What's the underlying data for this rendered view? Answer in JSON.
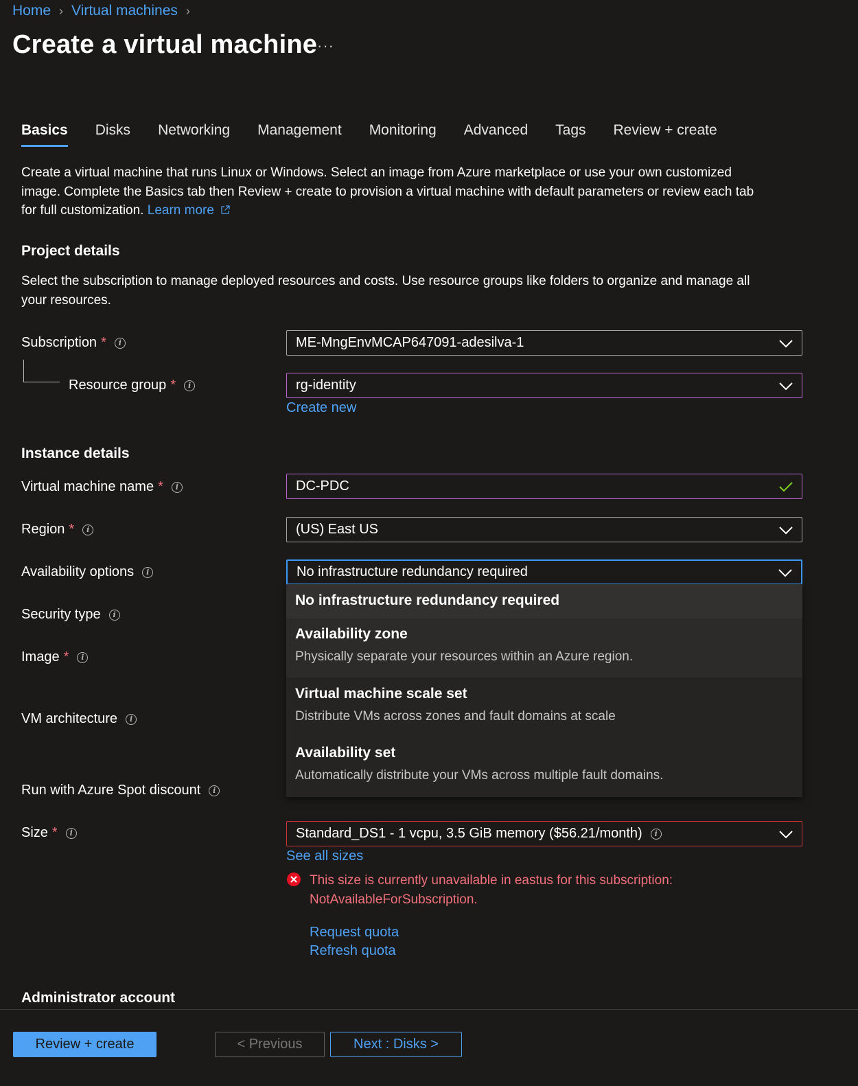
{
  "breadcrumb": {
    "home": "Home",
    "vms": "Virtual machines"
  },
  "title": "Create a virtual machine",
  "more": "···",
  "tabs": [
    "Basics",
    "Disks",
    "Networking",
    "Management",
    "Monitoring",
    "Advanced",
    "Tags",
    "Review + create"
  ],
  "intro": {
    "line1": "Create a virtual machine that runs Linux or Windows. Select an image from Azure marketplace or use your own customized",
    "line2": "image. Complete the Basics tab then Review + create to provision a virtual machine with default parameters or review each tab",
    "line3": "for full customization.",
    "learn_more": "Learn more"
  },
  "project": {
    "title": "Project details",
    "desc1": "Select the subscription to manage deployed resources and costs. Use resource groups like folders to organize and manage all",
    "desc2": "your resources.",
    "subscription_label": "Subscription",
    "subscription_value": "ME-MngEnvMCAP647091-adesilva-1",
    "rg_label": "Resource group",
    "rg_value": "rg-identity",
    "create_new": "Create new"
  },
  "instance": {
    "title": "Instance details",
    "vm_name_label": "Virtual machine name",
    "vm_name_value": "DC-PDC",
    "region_label": "Region",
    "region_value": "(US) East US",
    "availability_label": "Availability options",
    "availability_value": "No infrastructure redundancy required",
    "security_label": "Security type",
    "image_label": "Image",
    "arch_label": "VM architecture",
    "spot_label": "Run with Azure Spot discount",
    "size_label": "Size",
    "size_value": "Standard_DS1 - 1 vcpu, 3.5 GiB memory ($56.21/month)",
    "see_all_sizes": "See all sizes",
    "error1": "This size is currently unavailable in eastus for this subscription:",
    "error2": "NotAvailableForSubscription.",
    "request_quota": "Request quota",
    "refresh_quota": "Refresh quota"
  },
  "dropdown": [
    {
      "title": "No infrastructure redundancy required",
      "desc": ""
    },
    {
      "title": "Availability zone",
      "desc": "Physically separate your resources within an Azure region."
    },
    {
      "title": "Virtual machine scale set",
      "desc": "Distribute VMs across zones and fault domains at scale"
    },
    {
      "title": "Availability set",
      "desc": "Automatically distribute your VMs across multiple fault domains."
    }
  ],
  "admin": {
    "title": "Administrator account"
  },
  "footer": {
    "review_create": "Review + create",
    "previous": "< Previous",
    "next": "Next : Disks >"
  },
  "colors": {
    "accent": "#4ea1f3",
    "error": "#f1707b",
    "valid": "#7ed321",
    "focus_purple": "#c065d8",
    "background": "#1b1a19"
  }
}
